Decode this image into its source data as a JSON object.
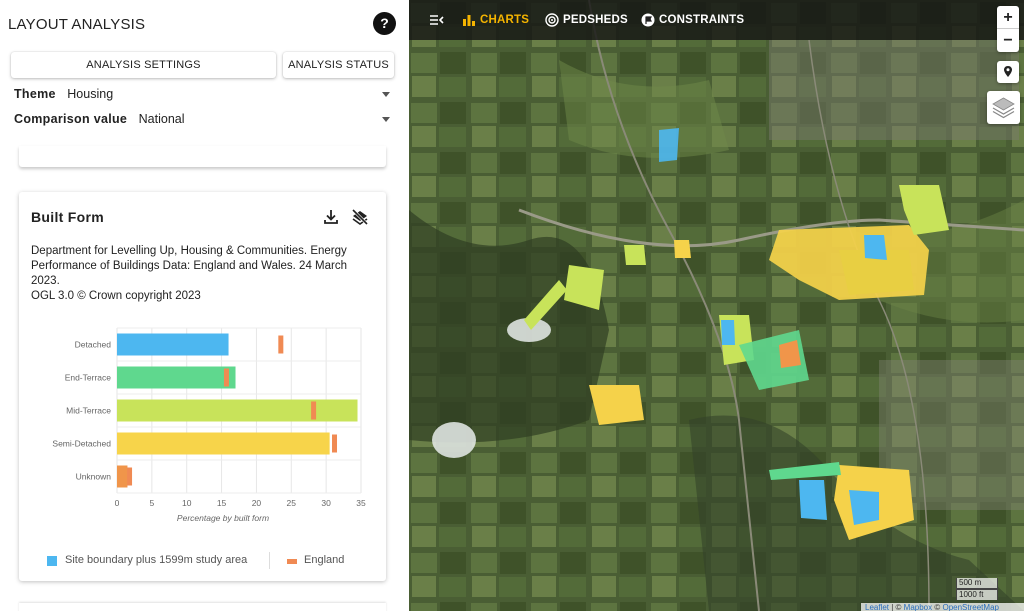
{
  "app": {
    "title": "LAYOUT ANALYSIS",
    "help_label": "?"
  },
  "tabs": {
    "settings": "ANALYSIS SETTINGS",
    "status": "ANALYSIS STATUS"
  },
  "selectors": {
    "theme": {
      "label": "Theme",
      "value": "Housing"
    },
    "comparison": {
      "label": "Comparison value",
      "value": "National"
    }
  },
  "card": {
    "title": "Built Form",
    "source_lines": [
      "Department for Levelling Up, Housing & Communities. Energy Performance of Buildings Data: England and Wales. 24 March 2023.",
      "OGL 3.0 © Crown copyright 2023"
    ],
    "icons": [
      "download-icon",
      "layers-off-icon"
    ]
  },
  "chart_data": {
    "type": "bar",
    "orientation": "horizontal",
    "categories": [
      "Detached",
      "End-Terrace",
      "Mid-Terrace",
      "Semi-Detached",
      "Unknown"
    ],
    "series": [
      {
        "name": "Site boundary plus 1599m study area",
        "values": [
          16,
          17,
          34.5,
          30.5,
          1.5
        ]
      },
      {
        "name": "England",
        "values": [
          23.5,
          15.7,
          28.2,
          31.2,
          1.8
        ]
      }
    ],
    "bar_colors": [
      "#4db7f0",
      "#5fd88e",
      "#c8e35a",
      "#f7d44a",
      "#f0954a"
    ],
    "marker_color": "#f08a53",
    "xlabel": "Percentage by built form",
    "xlim": [
      0,
      35
    ],
    "xticks": [
      "0",
      "5",
      "10",
      "15",
      "20",
      "25",
      "30",
      "35"
    ],
    "grid": true,
    "legend_position": "bottom"
  },
  "legend": {
    "items": [
      {
        "label": "Site boundary plus 1599m study area",
        "color": "#4db7f0"
      },
      {
        "label": "England",
        "color": "#f08a53"
      }
    ]
  },
  "map": {
    "nav": [
      {
        "label": "",
        "icon": "collapse-panel-icon"
      },
      {
        "label": "CHARTS",
        "icon": "bar-chart-icon",
        "active": true
      },
      {
        "label": "PEDSHEDS",
        "icon": "pedshed-icon"
      },
      {
        "label": "CONSTRAINTS",
        "icon": "flag-icon"
      }
    ],
    "zoom_in": "+",
    "zoom_out": "−",
    "scale_metric": "500 m",
    "scale_imperial": "1000 ft",
    "attribution": {
      "leaflet": "Leaflet",
      "sep": " | © ",
      "mapbox": "Mapbox",
      "sep2": " © ",
      "osm": "OpenStreetMap"
    },
    "active_color": "#f5b400"
  }
}
